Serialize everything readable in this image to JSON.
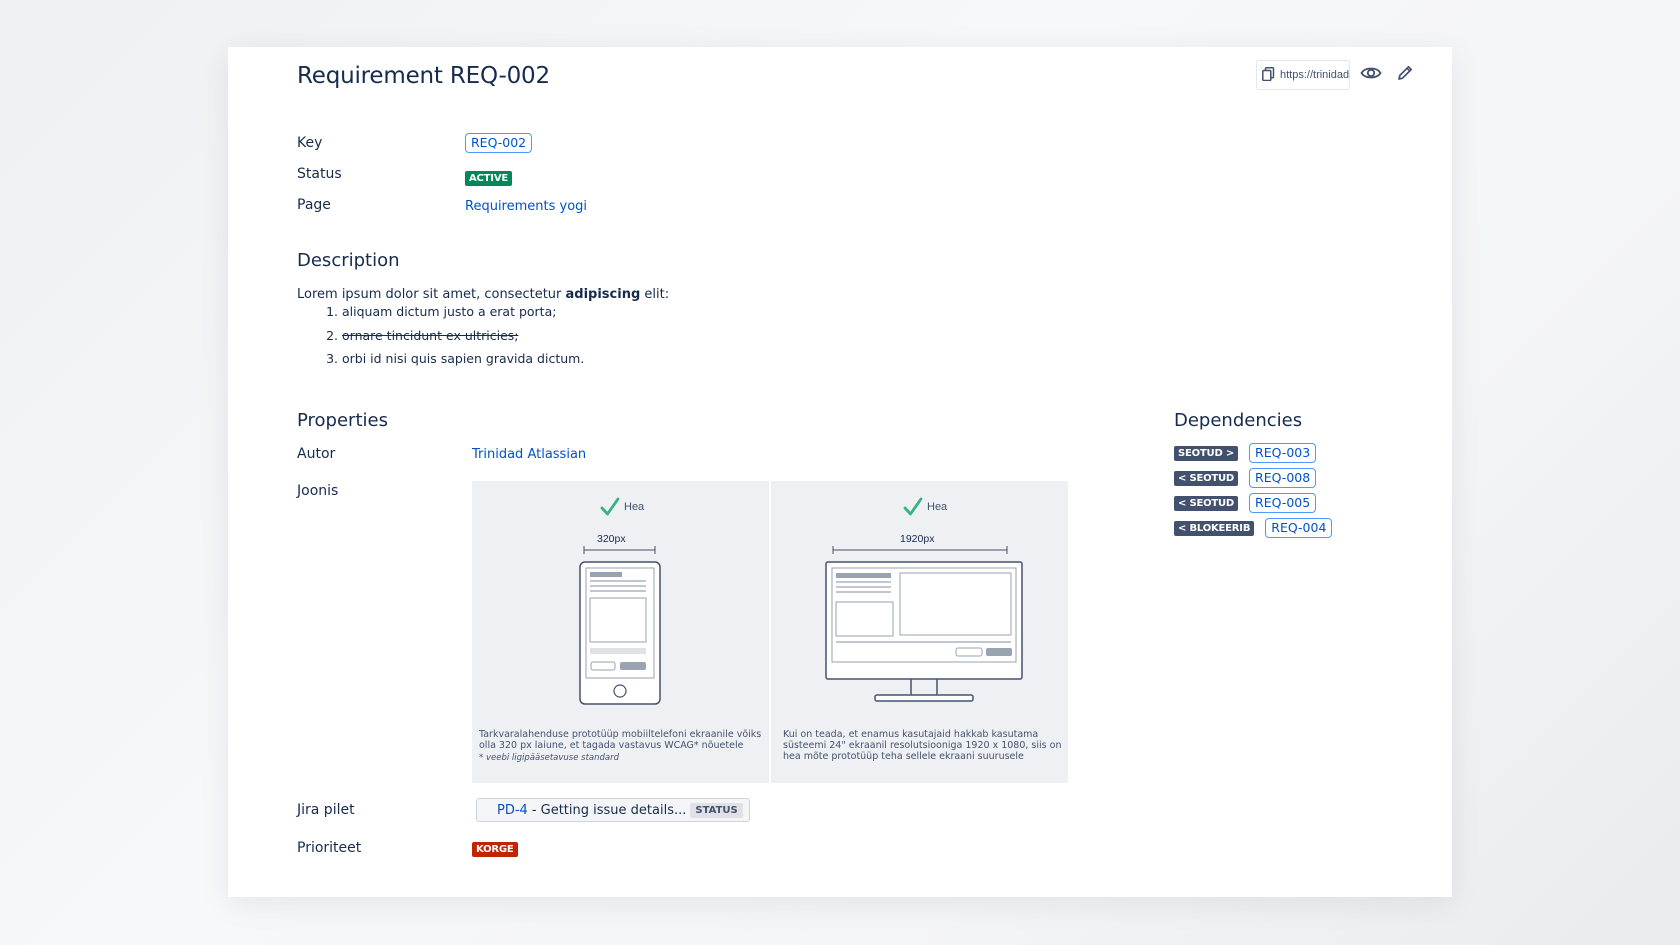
{
  "header": {
    "title": "Requirement REQ-002",
    "url_text": "https://trinidad.atlassian.net",
    "copy_icon": "copy-icon",
    "view_icon": "eye-icon",
    "edit_icon": "pencil-icon"
  },
  "meta": {
    "key_label": "Key",
    "key_value": "REQ-002",
    "status_label": "Status",
    "status_value": "ACTIVE",
    "status_color": "#00875a",
    "page_label": "Page",
    "page_value": "Requirements yogi"
  },
  "description": {
    "heading": "Description",
    "intro_prefix": "Lorem ipsum dolor sit amet, consectetur ",
    "intro_bold": "adipiscing",
    "intro_suffix": " elit:",
    "items": [
      "aliquam dictum justo a erat porta;",
      "ornare tincidunt ex ultricies;",
      "orbi id nisi quis sapien gravida dictum."
    ]
  },
  "properties": {
    "heading": "Properties",
    "author_label": "Autor",
    "author_value": "Trinidad Atlassian",
    "drawing_label": "Joonis",
    "drawing": {
      "left_check": "Hea",
      "left_width": "320px",
      "left_caption": "Tarkvaralahenduse prototüüp mobiiltelefoni ekraanile võiks olla 320 px laiune, et tagada vastavus WCAG* nõuetele",
      "left_note": "* veebi ligipääsetavuse standard",
      "right_check": "Hea",
      "right_width": "1920px",
      "right_caption": "Kui on teada, et enamus kasutajaid hakkab kasutama süsteemi 24\" ekraanil resolutsiooniga 1920 x 1080, siis on hea mõte prototüüp teha sellele ekraani suurusele"
    },
    "jira_label": "Jira pilet",
    "jira_key": "PD-4",
    "jira_text": "- Getting issue details...",
    "jira_status": "STATUS",
    "priority_label": "Prioriteet",
    "priority_value": "KORGE",
    "priority_color": "#bf2600"
  },
  "dependencies": {
    "heading": "Dependencies",
    "items": [
      {
        "relation": "SEOTUD >",
        "target": "REQ-003"
      },
      {
        "relation": "< SEOTUD",
        "target": "REQ-008"
      },
      {
        "relation": "< SEOTUD",
        "target": "REQ-005"
      },
      {
        "relation": "< BLOKEERIB",
        "target": "REQ-004"
      }
    ],
    "badge_color": "#42526e"
  },
  "colors": {
    "link": "#0052cc",
    "outline": "#4c9aff",
    "check": "#36b37e"
  }
}
